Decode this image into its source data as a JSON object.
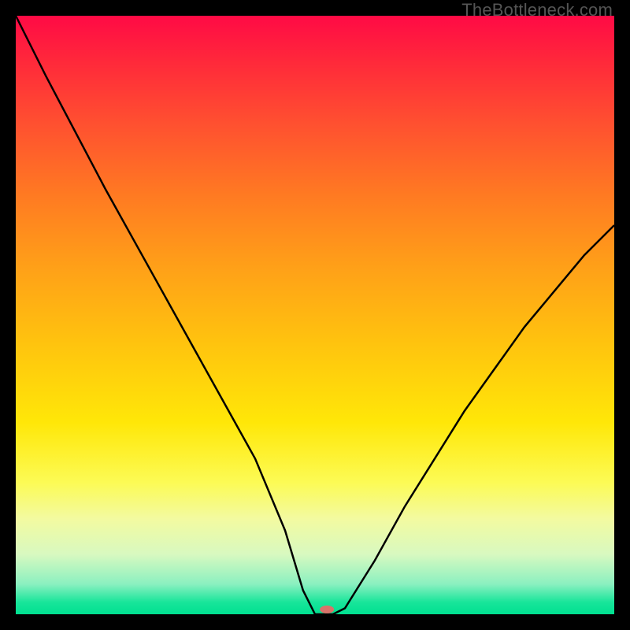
{
  "watermark": "TheBottleneck.com",
  "chart_data": {
    "type": "line",
    "title": "",
    "xlabel": "",
    "ylabel": "",
    "xlim": [
      0,
      100
    ],
    "ylim": [
      0,
      100
    ],
    "grid": false,
    "legend": false,
    "series": [
      {
        "name": "curve",
        "x": [
          0,
          5,
          10,
          15,
          20,
          25,
          30,
          35,
          40,
          45,
          48,
          50,
          53,
          55,
          60,
          65,
          70,
          75,
          80,
          85,
          90,
          95,
          100
        ],
        "y": [
          100,
          90,
          80.5,
          71,
          62,
          53,
          44,
          35,
          26,
          14,
          4,
          0,
          0,
          1,
          9,
          18,
          26,
          34,
          41,
          48,
          54,
          60,
          65
        ]
      }
    ],
    "marker": {
      "x": 52,
      "y": 0.8,
      "color": "#d9736a",
      "rx": 9,
      "ry": 5
    }
  }
}
